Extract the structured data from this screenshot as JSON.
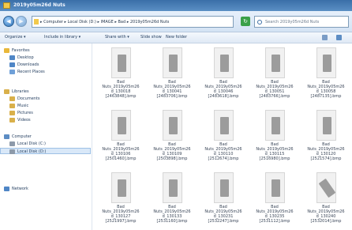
{
  "window": {
    "title": "2019y05m26d Nuts"
  },
  "address": {
    "path": "▸ Computer ▸ Local Disk (D:) ▸ IMAGE ▸ Bad ▸ 2019y05m26d Nuts"
  },
  "search": {
    "placeholder": "Search 2019y05m26d Nuts"
  },
  "toolbar": {
    "organize": "Organize ▾",
    "include": "Include in library ▾",
    "share": "Share with ▾",
    "slideshow": "Slide show",
    "newfolder": "New folder"
  },
  "nav": [
    {
      "label": "Favorites",
      "icon": "star-icon",
      "color": "#e9b83a"
    },
    {
      "label": "Desktop",
      "icon": "desktop-icon",
      "color": "#4f86c6"
    },
    {
      "label": "Downloads",
      "icon": "downloads-icon",
      "color": "#4f86c6"
    },
    {
      "label": "Recent Places",
      "icon": "recent-places-icon",
      "color": "#6fa0d8"
    },
    {
      "label": "Libraries",
      "icon": "libraries-icon",
      "color": "#d9b04a"
    },
    {
      "label": "Documents",
      "icon": "documents-icon",
      "color": "#d9b04a"
    },
    {
      "label": "Music",
      "icon": "music-icon",
      "color": "#d9b04a"
    },
    {
      "label": "Pictures",
      "icon": "pictures-icon",
      "color": "#d9b04a"
    },
    {
      "label": "Videos",
      "icon": "videos-icon",
      "color": "#d9b04a"
    },
    {
      "label": "Computer",
      "icon": "computer-icon",
      "color": "#5d8dc4"
    },
    {
      "label": "Local Disk (C:)",
      "icon": "disk-icon",
      "color": "#8d9aaa"
    },
    {
      "label": "Local Disk (D:)",
      "icon": "disk-icon",
      "color": "#8d9aaa"
    },
    {
      "label": "Network",
      "icon": "network-icon",
      "color": "#4f86c6"
    }
  ],
  "files": [
    {
      "name": "Bad\nNuts_2019y05m26\nd_130018\n[2463848].bmp"
    },
    {
      "name": "Bad\nNuts_2019y05m26\nd_130041\n[2483706].bmp"
    },
    {
      "name": "Bad\nNuts_2019y05m26\nd_130046\n[2483618].bmp"
    },
    {
      "name": "Bad\nNuts_2019y05m26\nd_130051\n[2483766].bmp"
    },
    {
      "name": "Bad\nNuts_2019y05m26\nd_130058\n[2487135].bmp"
    },
    {
      "name": "Bad\nNuts_2019y05m26\nd_130106\n[2501460].bmp"
    },
    {
      "name": "Bad\nNuts_2019y05m26\nd_130109\n[2503898].bmp"
    },
    {
      "name": "Bad\nNuts_2019y05m26\nd_130110\n[2512674].bmp"
    },
    {
      "name": "Bad\nNuts_2019y05m26\nd_130115\n[2516980].bmp"
    },
    {
      "name": "Bad\nNuts_2019y05m26\nd_130120\n[2521574].bmp"
    },
    {
      "name": "Bad\nNuts_2019y05m26\nd_130127\n[2521997].bmp"
    },
    {
      "name": "Bad\nNuts_2019y05m26\nd_130133\n[2531160].bmp"
    },
    {
      "name": "Bad\nNuts_2019y05m26\nd_130231\n[2532247].bmp"
    },
    {
      "name": "Bad\nNuts_2019y05m26\nd_130235\n[2531112].bmp"
    },
    {
      "name": "Bad\nNuts_2019y05m26\nd_130240\n[2532014].bmp"
    }
  ]
}
